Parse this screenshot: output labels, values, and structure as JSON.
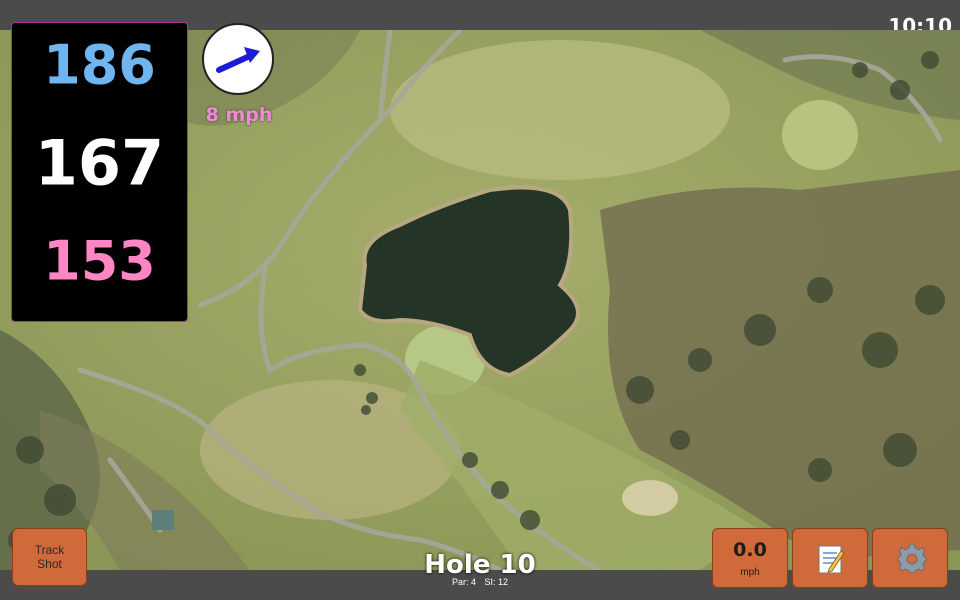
{
  "status": {
    "time": "10:10"
  },
  "distances": {
    "back": "186",
    "middle": "167",
    "front": "153"
  },
  "wind": {
    "speed": "8 mph",
    "icon": "wind-arrow-icon"
  },
  "track_shot": {
    "line1": "Track",
    "line2": "Shot"
  },
  "swing_speed": {
    "value": "0.0",
    "unit": "mph"
  },
  "notes": {
    "icon": "notepad-icon"
  },
  "settings": {
    "icon": "gear-icon"
  },
  "hole": {
    "title": "Hole 10",
    "par": "Par: 4",
    "si": "SI: 12"
  },
  "colors": {
    "back_distance": "#6fb5f0",
    "middle_distance": "#ffffff",
    "front_distance": "#ff86c3",
    "wind_text": "#f08ad8",
    "button_orange": "#d06a3b"
  }
}
